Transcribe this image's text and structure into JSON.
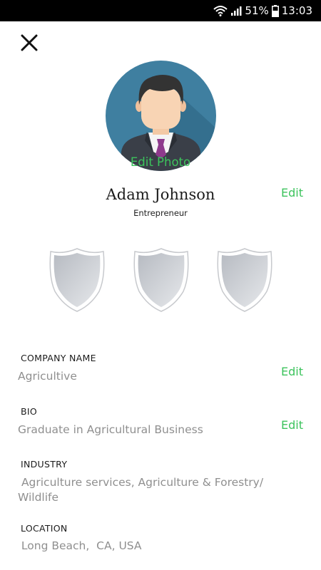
{
  "status_bar": {
    "battery_percent": "51%",
    "time": "13:03",
    "icons": [
      "wifi-icon",
      "signal-icon",
      "battery-icon"
    ]
  },
  "header": {
    "close_icon": "close-icon"
  },
  "profile": {
    "edit_photo_label": "Edit Photo",
    "name": "Adam Johnson",
    "role": "Entrepreneur",
    "edit_label": "Edit",
    "badges": [
      "shield-badge",
      "shield-badge",
      "shield-badge"
    ]
  },
  "fields": {
    "company": {
      "label": "COMPANY NAME",
      "value": "Agricultive",
      "edit_label": "Edit"
    },
    "bio": {
      "label": "BIO",
      "value": "Graduate in Agricultural Business",
      "edit_label": "Edit"
    },
    "industry": {
      "label": "INDUSTRY",
      "value": " Agriculture services, Agriculture & Forestry/ Wildlife"
    },
    "location": {
      "label": "LOCATION",
      "value": " Long Beach,  CA, USA"
    }
  },
  "colors": {
    "accent": "#3cc35c",
    "value_text": "#8f8f8f",
    "avatar_bg": "#3f7fa0",
    "status_bar": "#000000"
  }
}
